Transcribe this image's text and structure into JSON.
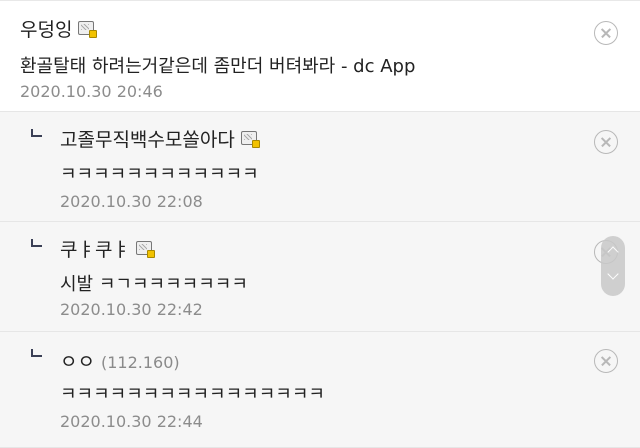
{
  "comments": [
    {
      "nickname": "우덩잉",
      "body": "환골탈태 하려는거같은데 좀만더 버텨봐라 - dc App",
      "date": "2020.10.30 20:46"
    }
  ],
  "replies": [
    {
      "nickname": "고졸무직백수모쏠아다",
      "body": "ㅋㅋㅋㅋㅋㅋㅋㅋㅋㅋㅋㅋ",
      "date": "2020.10.30 22:08"
    },
    {
      "nickname": "쿠ㅑ쿠ㅑ",
      "body": "시발 ㅋㄱㅋㅋㅋㅋㅋㅋㅋ",
      "date": "2020.10.30 22:42"
    },
    {
      "nickname": "ㅇㅇ",
      "ip": "(112.160)",
      "body": "ㅋㅋㅋㅋㅋㅋㅋㅋㅋㅋㅋㅋㅋㅋㅋㅋ",
      "date": "2020.10.30 22:44"
    }
  ],
  "icons": {
    "mobile_badge": "mobile-device-icon",
    "delete": "close-circle-icon",
    "reply": "reply-arrow-icon",
    "scroll_up": "chevron-up-icon",
    "scroll_down": "chevron-down-icon"
  },
  "colors": {
    "reply_background": "#f6f6f6",
    "date_text": "#8c8c8c",
    "reply_arrow": "#3a3f55",
    "delete_icon": "#b8b8b8"
  }
}
